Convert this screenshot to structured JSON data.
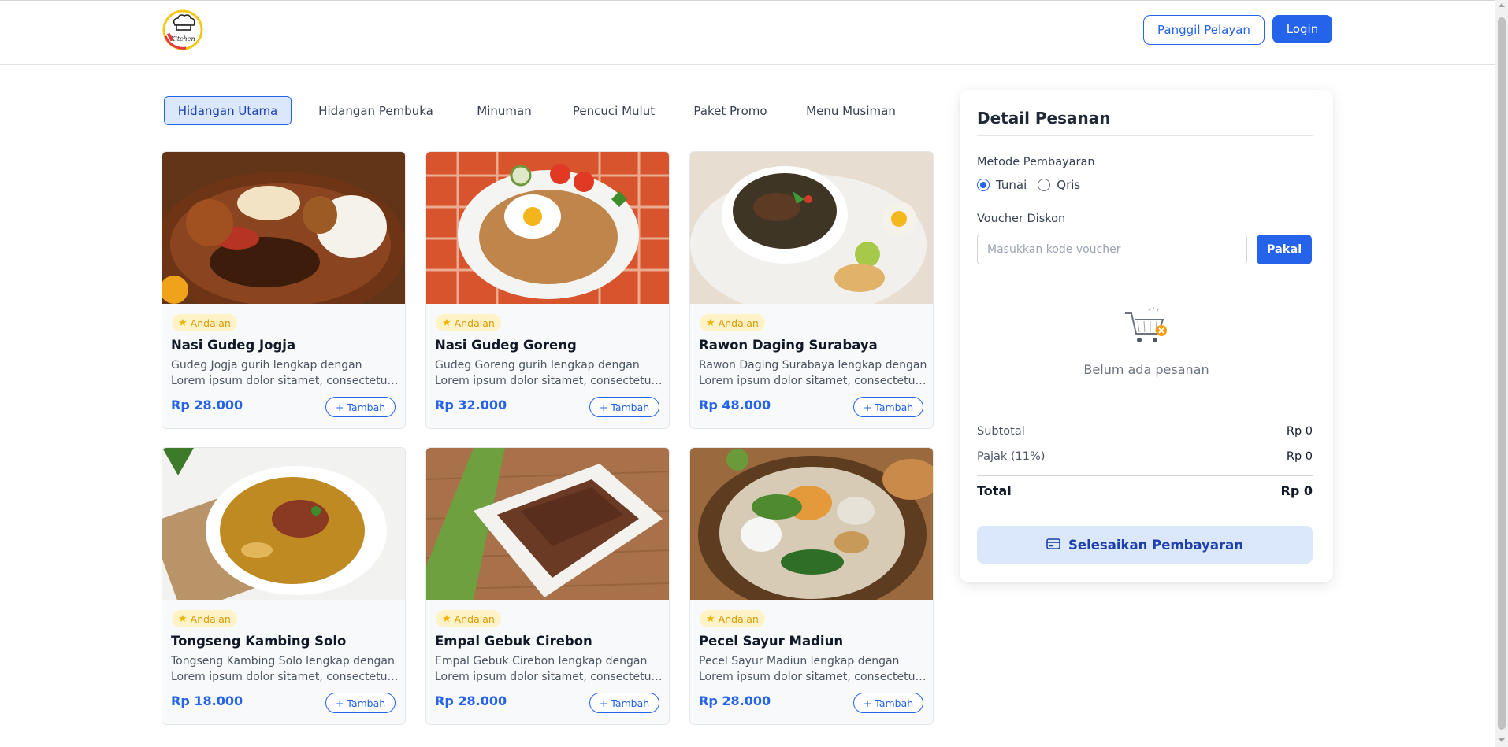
{
  "header": {
    "logo_text": "Kitchen",
    "waiter_button": "Panggil Pelayan",
    "login_button": "Login"
  },
  "tabs": [
    {
      "label": "Hidangan Utama",
      "active": true
    },
    {
      "label": "Hidangan Pembuka",
      "active": false
    },
    {
      "label": "Minuman",
      "active": false
    },
    {
      "label": "Pencuci Mulut",
      "active": false
    },
    {
      "label": "Paket Promo",
      "active": false
    },
    {
      "label": "Menu Musiman",
      "active": false
    }
  ],
  "menu": [
    {
      "badge": "Andalan",
      "name": "Nasi Gudeg Jogja",
      "desc": "Gudeg Jogja gurih lengkap dengan Lorem ipsum dolor sitamet, consectetur adipiscing elit",
      "price": "Rp 28.000",
      "add": "+ Tambah",
      "image": "gudeg-plate"
    },
    {
      "badge": "Andalan",
      "name": "Nasi Gudeg Goreng",
      "desc": "Gudeg Goreng gurih lengkap dengan Lorem ipsum dolor sitamet, consectetur adipiscing elit",
      "price": "Rp 32.000",
      "add": "+ Tambah",
      "image": "fried-rice-egg"
    },
    {
      "badge": "Andalan",
      "name": "Rawon Daging Surabaya",
      "desc": "Rawon Daging Surabaya lengkap dengan Lorem ipsum dolor sitamet, consectetur adipiscing elit",
      "price": "Rp 48.000",
      "add": "+ Tambah",
      "image": "rawon-bowl"
    },
    {
      "badge": "Andalan",
      "name": "Tongseng Kambing Solo",
      "desc": "Tongseng Kambing Solo lengkap dengan Lorem ipsum dolor sitamet, consectetur adipiscing elit",
      "price": "Rp 18.000",
      "add": "+ Tambah",
      "image": "tongseng-bowl"
    },
    {
      "badge": "Andalan",
      "name": "Empal Gebuk Cirebon",
      "desc": "Empal Gebuk Cirebon lengkap dengan Lorem ipsum dolor sitamet, consectetur adipiscing elit",
      "price": "Rp 28.000",
      "add": "+ Tambah",
      "image": "empal-plate"
    },
    {
      "badge": "Andalan",
      "name": "Pecel Sayur Madiun",
      "desc": "Pecel Sayur Madiun lengkap dengan Lorem ipsum dolor sitamet, consectetur adipiscing elit",
      "price": "Rp 28.000",
      "add": "+ Tambah",
      "image": "pecel-plate"
    }
  ],
  "order": {
    "title": "Detail Pesanan",
    "payment_label": "Metode Pembayaran",
    "payment_options": [
      {
        "label": "Tunai",
        "selected": true
      },
      {
        "label": "Qris",
        "selected": false
      }
    ],
    "voucher_label": "Voucher Diskon",
    "voucher_placeholder": "Masukkan kode voucher",
    "voucher_value": "",
    "apply_button": "Pakai",
    "empty_text": "Belum ada pesanan",
    "subtotal_label": "Subtotal",
    "subtotal_value": "Rp 0",
    "tax_label": "Pajak (11%)",
    "tax_value": "Rp 0",
    "total_label": "Total",
    "total_value": "Rp 0",
    "pay_button": "Selesaikan Pembayaran"
  },
  "colors": {
    "primary": "#2563eb",
    "badge_bg": "#fef3c7",
    "badge_text": "#d99a06",
    "active_tab_bg": "#dbe8fc"
  }
}
